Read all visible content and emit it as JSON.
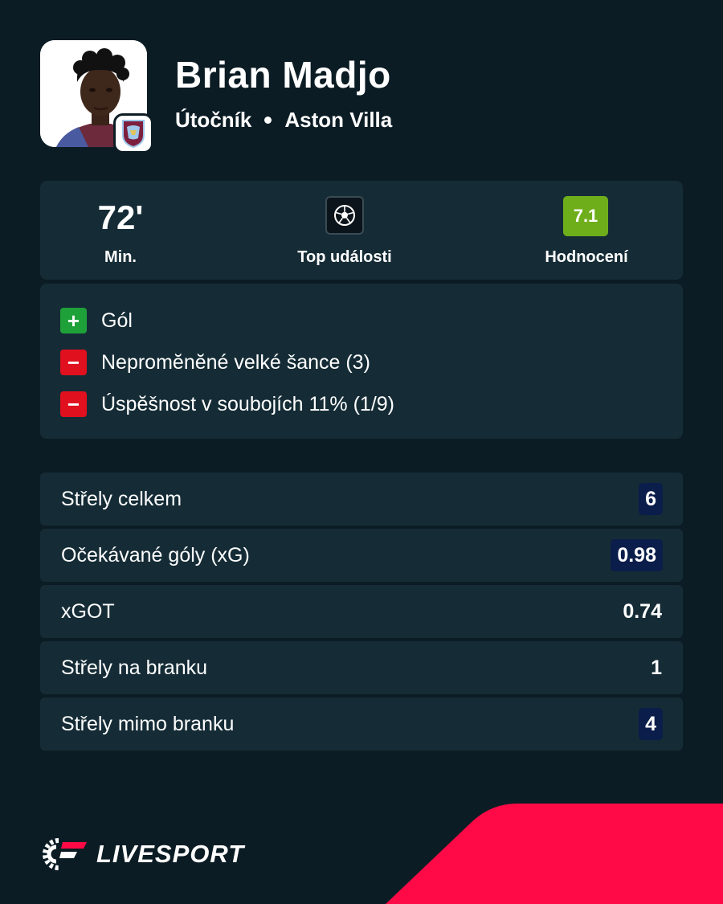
{
  "player": {
    "name": "Brian Madjo",
    "position": "Útočník",
    "team": "Aston Villa"
  },
  "summary": {
    "minutes_value": "72'",
    "minutes_label": "Min.",
    "events_label": "Top události",
    "rating_value": "7.1",
    "rating_label": "Hodnocení",
    "rating_color": "#6fae1b"
  },
  "events": [
    {
      "sign": "+",
      "type": "positive",
      "text": "Gól"
    },
    {
      "sign": "−",
      "type": "negative",
      "text": "Nepromĕnĕné velké šance (3)"
    },
    {
      "sign": "−",
      "type": "negative",
      "text": "Úspĕšnost v soubojích 11% (1/9)"
    }
  ],
  "stats": [
    {
      "label": "Střely celkem",
      "value": "6",
      "highlighted": true
    },
    {
      "label": "Očekávané góly (xG)",
      "value": "0.98",
      "highlighted": true
    },
    {
      "label": "xGOT",
      "value": "0.74",
      "highlighted": false
    },
    {
      "label": "Střely na branku",
      "value": "1",
      "highlighted": false
    },
    {
      "label": "Střely mimo branku",
      "value": "4",
      "highlighted": true
    }
  ],
  "brand": {
    "logo_text": "LIVESPORT",
    "accent_color": "#ff0a46"
  },
  "icons": {
    "events": "football-icon",
    "club": "aston-villa-crest-icon"
  }
}
